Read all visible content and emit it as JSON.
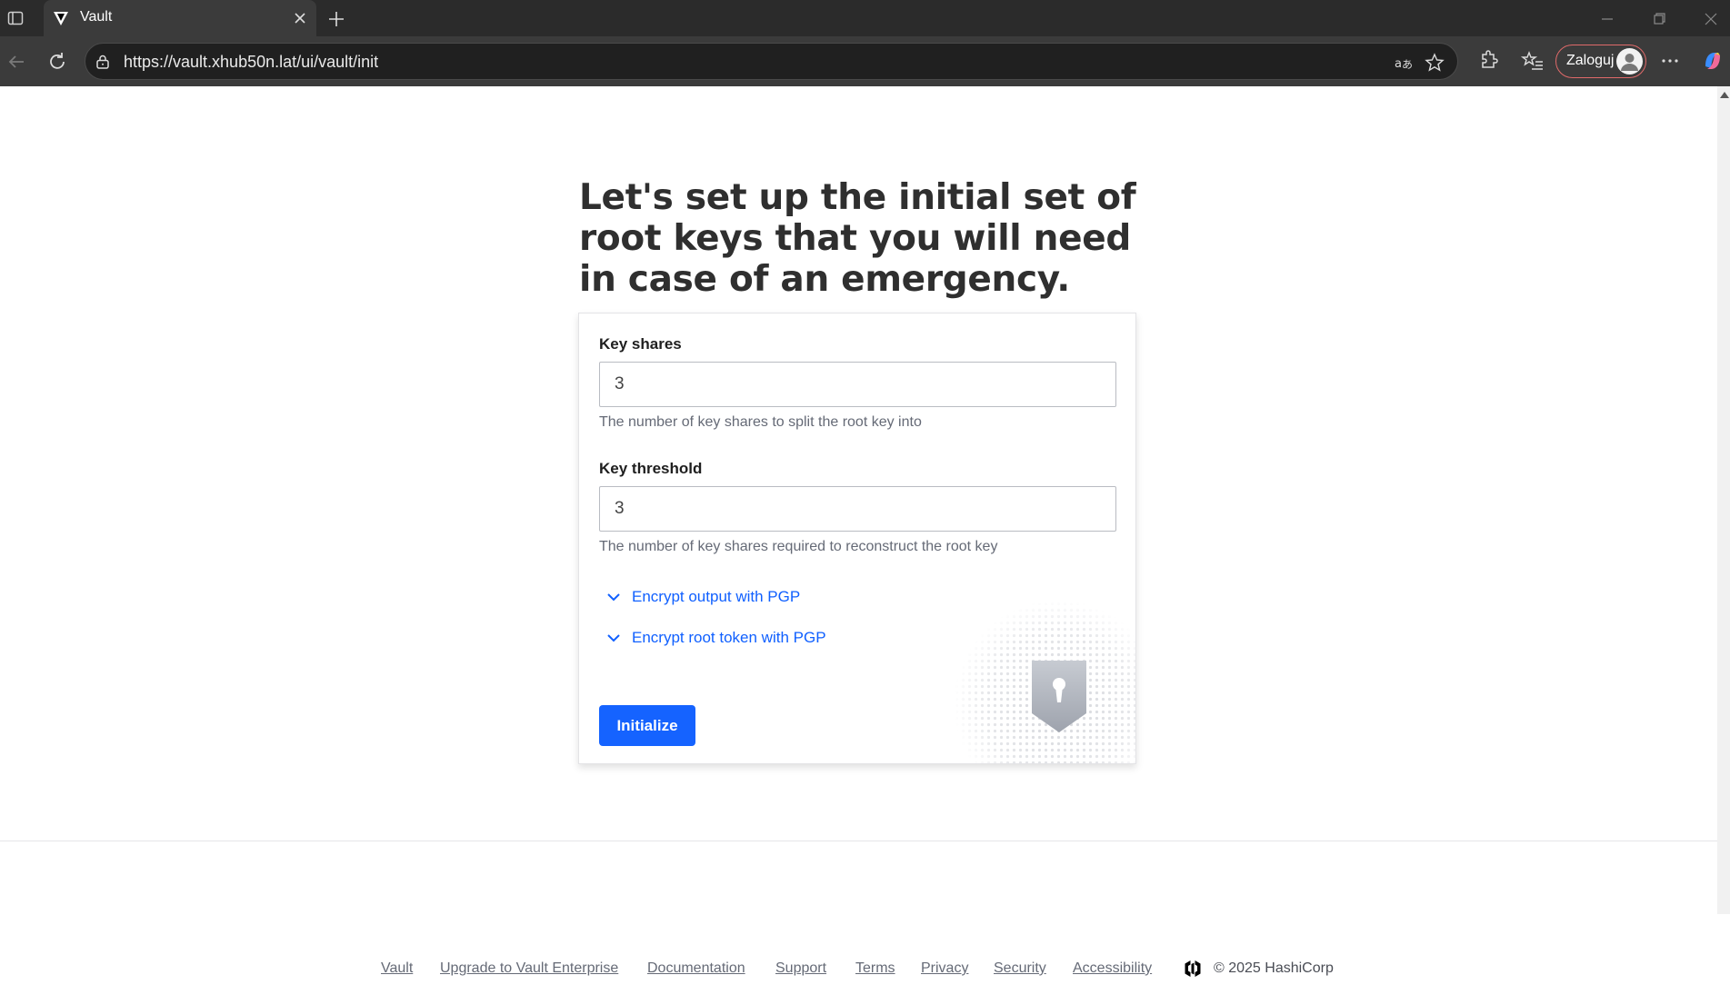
{
  "browser": {
    "tab_title": "Vault",
    "url": "https://vault.xhub50n.lat/ui/vault/init",
    "profile_label": "Zaloguj"
  },
  "page": {
    "heading": "Let's set up the initial set of root keys that you will need in case of an emergency.",
    "key_shares": {
      "label": "Key shares",
      "value": "3",
      "help": "The number of key shares to split the root key into"
    },
    "key_threshold": {
      "label": "Key threshold",
      "value": "3",
      "help": "The number of key shares required to reconstruct the root key"
    },
    "toggles": [
      {
        "label": "Encrypt output with PGP"
      },
      {
        "label": "Encrypt root token with PGP"
      }
    ],
    "initialize_label": "Initialize"
  },
  "footer": {
    "links": [
      {
        "label": "Vault"
      },
      {
        "label": "Upgrade to Vault Enterprise"
      },
      {
        "label": "Documentation"
      },
      {
        "label": "Support"
      },
      {
        "label": "Terms"
      },
      {
        "label": "Privacy"
      },
      {
        "label": "Security"
      },
      {
        "label": "Accessibility"
      }
    ],
    "copyright": "© 2025 HashiCorp"
  },
  "colors": {
    "accent": "#1563ff",
    "link": "#1060ff",
    "browser_dark": "#2b2b2b"
  }
}
